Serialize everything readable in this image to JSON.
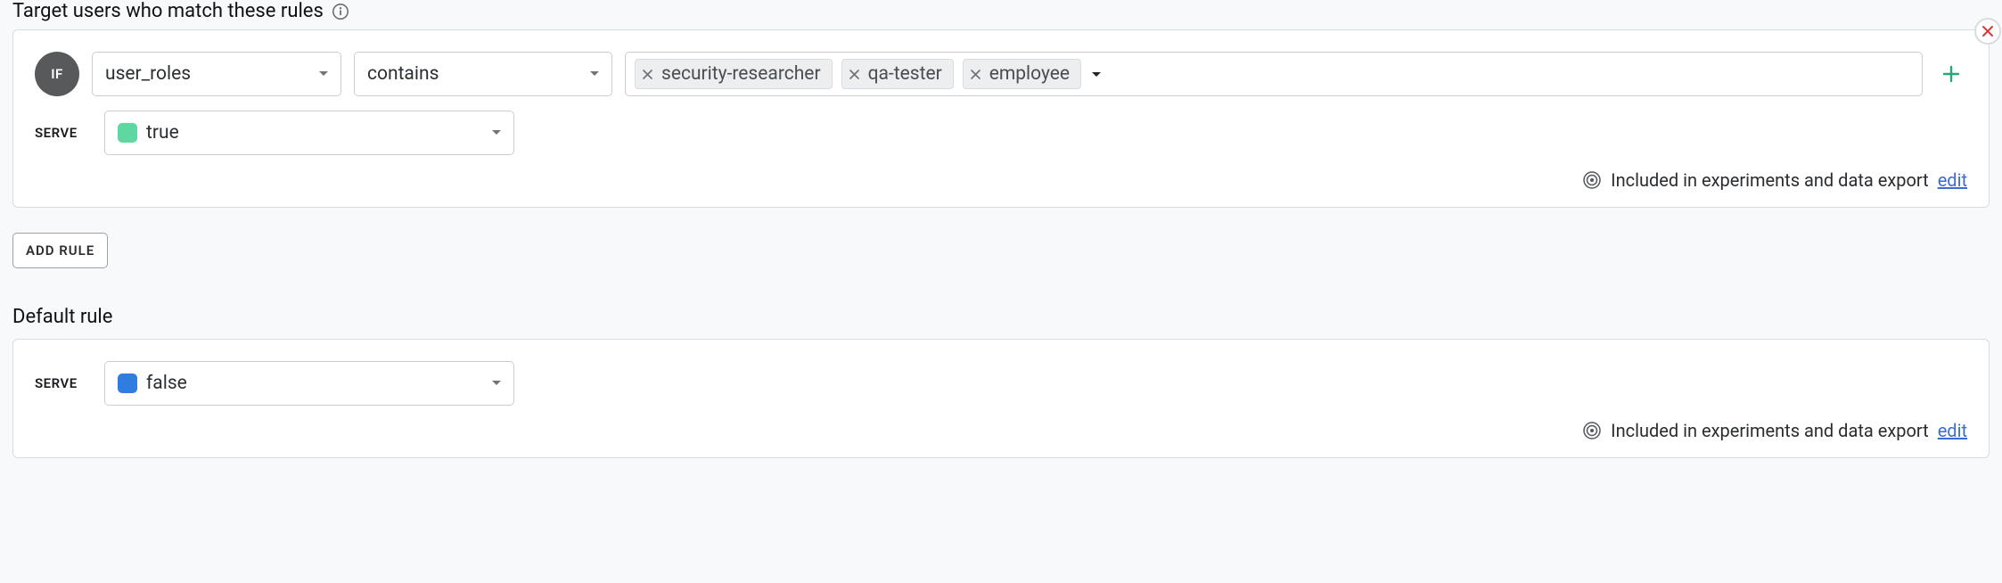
{
  "rules_section": {
    "title": "Target users who match these rules",
    "rule": {
      "if_badge": "IF",
      "attribute": "user_roles",
      "operator": "contains",
      "values": [
        "security-researcher",
        "qa-tester",
        "employee"
      ],
      "serve_label": "SERVE",
      "serve_value": "true",
      "serve_swatch": "#5fd7a0",
      "footer_text": "Included in experiments and data export",
      "edit_label": "edit"
    },
    "add_rule_label": "ADD RULE"
  },
  "default_section": {
    "title": "Default rule",
    "serve_label": "SERVE",
    "serve_value": "false",
    "serve_swatch": "#2f7de1",
    "footer_text": "Included in experiments and data export",
    "edit_label": "edit"
  }
}
